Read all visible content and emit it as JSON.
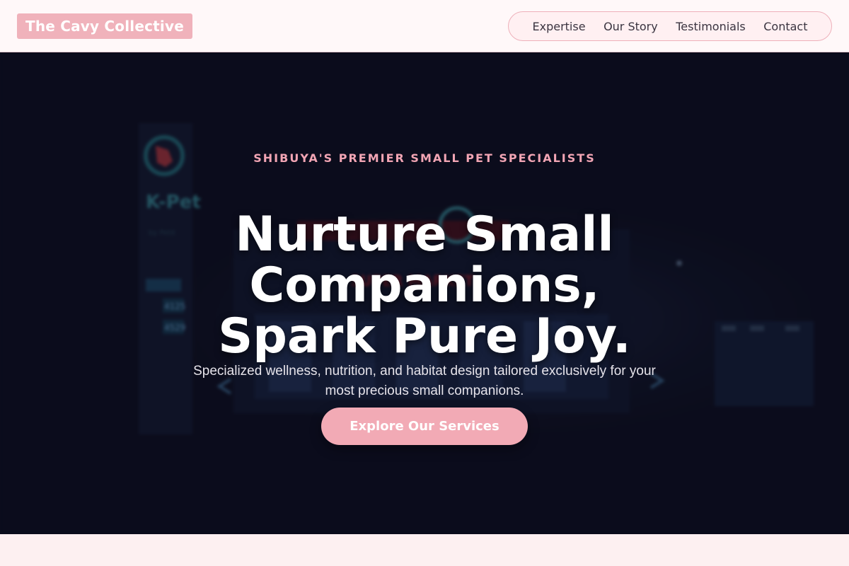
{
  "header": {
    "logo_text": "The Cavy Collective",
    "nav": [
      "Expertise",
      "Our Story",
      "Testimonials",
      "Contact"
    ]
  },
  "hero": {
    "eyebrow": "SHIBUYA'S PREMIER SMALL PET SPECIALISTS",
    "headline_lines": [
      "Nurture Small",
      "Companions,",
      "Spark Pure Joy."
    ],
    "subtext": "Specialized wellness, nutrition, and habitat design tailored exclusively for your most precious small companions.",
    "cta_label": "Explore Our Services",
    "background_sign_text": {
      "brand": "K-Pet",
      "sub": "by Petit",
      "market": "SUPER MARKET",
      "prices": [
        "4125",
        "4529"
      ]
    }
  },
  "colors": {
    "accent_pink": "#f0b2bb",
    "hero_bg": "#0b0d1c",
    "eyebrow": "#f2a5b4",
    "page_bg": "#fdf0f1"
  }
}
